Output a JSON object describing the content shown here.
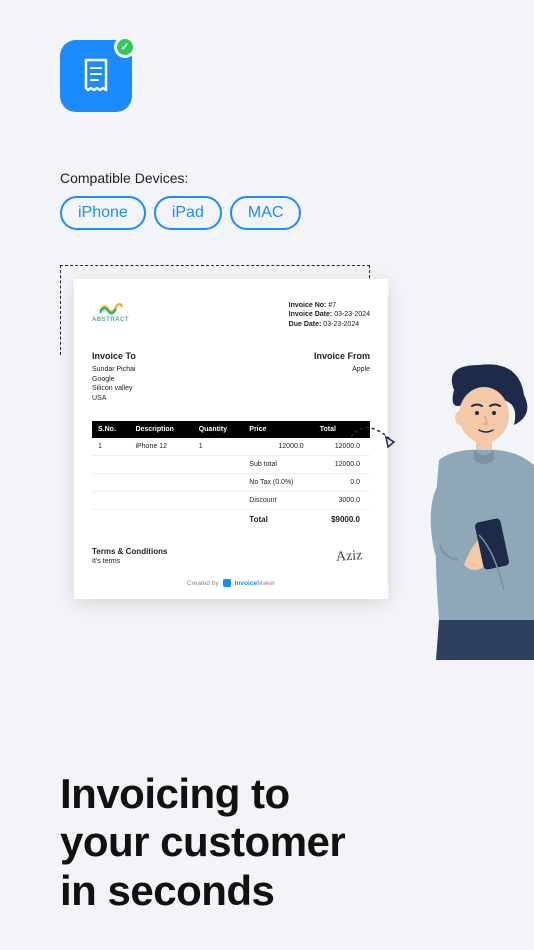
{
  "compat": {
    "title": "Compatible Devices:",
    "pills": [
      "iPhone",
      "iPad",
      "MAC"
    ]
  },
  "invoice": {
    "logo_text": "ABSTRACT",
    "meta": {
      "no_label": "Invoice No:",
      "no_value": "#7",
      "date_label": "Invoice Date:",
      "date_value": "03-23-2024",
      "due_label": "Due Date:",
      "due_value": "03-23-2024"
    },
    "to": {
      "heading": "Invoice To",
      "name": "Sundar Pichai",
      "company": "Google",
      "city": "Silicon valley",
      "country": "USA"
    },
    "from": {
      "heading": "Invoice From",
      "name": "Apple"
    },
    "table": {
      "headers": [
        "S.No.",
        "Description",
        "Quantity",
        "Price",
        "Total"
      ],
      "rows": [
        {
          "sno": "1",
          "desc": "iPhone 12",
          "qty": "1",
          "price": "12000.0",
          "total": "12000.0"
        }
      ],
      "summary": [
        {
          "label": "Sub total",
          "value": "12000.0"
        },
        {
          "label": "No Tax (0.0%)",
          "value": "0.0"
        },
        {
          "label": "Discount",
          "value": "3000.0"
        }
      ],
      "grand_label": "Total",
      "grand_value": "$9000.0"
    },
    "terms": {
      "heading": "Terms & Conditions",
      "body": "It's terms"
    },
    "signature": "Aziz",
    "footer": {
      "prefix": "Created by",
      "brand1": "Invoice",
      "brand2": "Maker"
    }
  },
  "headline": {
    "l1": "Invoicing to",
    "l2": "your customer",
    "l3": "in seconds"
  }
}
